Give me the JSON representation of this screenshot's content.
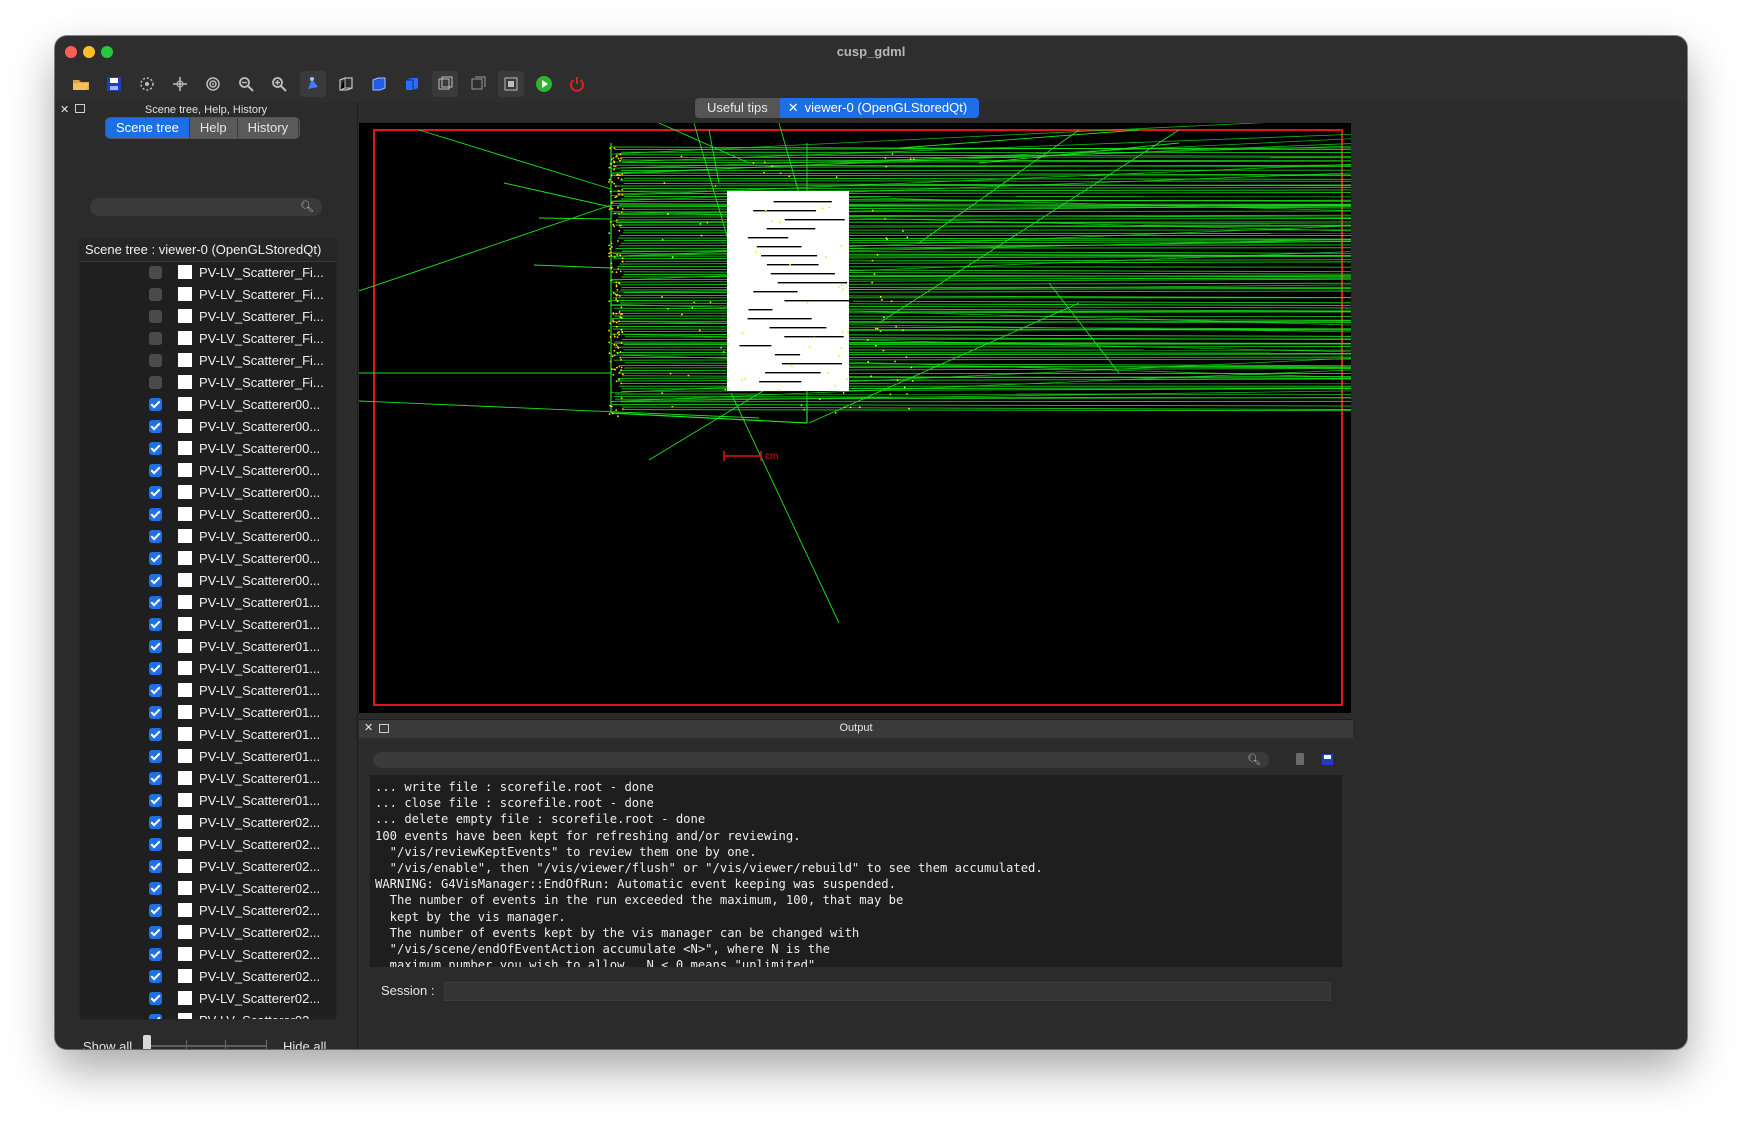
{
  "window": {
    "title": "cusp_gdml"
  },
  "toolbar": {
    "icons": [
      "open-folder-icon",
      "save-icon",
      "rotate-icon",
      "move-icon",
      "pick-icon",
      "zoom-out-icon",
      "zoom-in-icon",
      "perspective-icon",
      "hidden-line-icon",
      "solid-icon",
      "surface-icon",
      "wireframe-icon",
      "hidden-line-removal-icon",
      "hidden-surface-icon",
      "run-beam-icon",
      "exit-icon"
    ]
  },
  "left_dock": {
    "title": "Scene tree, Help, History",
    "tabs": [
      "Scene tree",
      "Help",
      "History"
    ],
    "selected_tab": "Scene tree",
    "search_placeholder": "",
    "tree_header": "Scene tree : viewer-0 (OpenGLStoredQt)",
    "items": [
      {
        "label": "PV-LV_Scatterer_Fi...",
        "checked": false
      },
      {
        "label": "PV-LV_Scatterer_Fi...",
        "checked": false
      },
      {
        "label": "PV-LV_Scatterer_Fi...",
        "checked": false
      },
      {
        "label": "PV-LV_Scatterer_Fi...",
        "checked": false
      },
      {
        "label": "PV-LV_Scatterer_Fi...",
        "checked": false
      },
      {
        "label": "PV-LV_Scatterer_Fi...",
        "checked": false
      },
      {
        "label": "PV-LV_Scatterer00...",
        "checked": true
      },
      {
        "label": "PV-LV_Scatterer00...",
        "checked": true
      },
      {
        "label": "PV-LV_Scatterer00...",
        "checked": true
      },
      {
        "label": "PV-LV_Scatterer00...",
        "checked": true
      },
      {
        "label": "PV-LV_Scatterer00...",
        "checked": true
      },
      {
        "label": "PV-LV_Scatterer00...",
        "checked": true
      },
      {
        "label": "PV-LV_Scatterer00...",
        "checked": true
      },
      {
        "label": "PV-LV_Scatterer00...",
        "checked": true
      },
      {
        "label": "PV-LV_Scatterer00...",
        "checked": true
      },
      {
        "label": "PV-LV_Scatterer01...",
        "checked": true
      },
      {
        "label": "PV-LV_Scatterer01...",
        "checked": true
      },
      {
        "label": "PV-LV_Scatterer01...",
        "checked": true
      },
      {
        "label": "PV-LV_Scatterer01...",
        "checked": true
      },
      {
        "label": "PV-LV_Scatterer01...",
        "checked": true
      },
      {
        "label": "PV-LV_Scatterer01...",
        "checked": true
      },
      {
        "label": "PV-LV_Scatterer01...",
        "checked": true
      },
      {
        "label": "PV-LV_Scatterer01...",
        "checked": true
      },
      {
        "label": "PV-LV_Scatterer01...",
        "checked": true
      },
      {
        "label": "PV-LV_Scatterer01...",
        "checked": true
      },
      {
        "label": "PV-LV_Scatterer02...",
        "checked": true
      },
      {
        "label": "PV-LV_Scatterer02...",
        "checked": true
      },
      {
        "label": "PV-LV_Scatterer02...",
        "checked": true
      },
      {
        "label": "PV-LV_Scatterer02...",
        "checked": true
      },
      {
        "label": "PV-LV_Scatterer02...",
        "checked": true
      },
      {
        "label": "PV-LV_Scatterer02...",
        "checked": true
      },
      {
        "label": "PV-LV_Scatterer02...",
        "checked": true
      },
      {
        "label": "PV-LV_Scatterer02...",
        "checked": true
      },
      {
        "label": "PV-LV_Scatterer02...",
        "checked": true
      },
      {
        "label": "PV-LV_Scatterer02...",
        "checked": true
      }
    ],
    "show_all": "Show all",
    "hide_all": "Hide all"
  },
  "viewer": {
    "tabs": [
      {
        "label": "Useful tips"
      },
      {
        "label": "viewer-0 (OpenGLStoredQt)",
        "close": "✕"
      }
    ],
    "scale_label": "cm",
    "colors": {
      "boundary": "#e0161b",
      "tracks": "#19e619",
      "steps": "#ffe400",
      "detector": "#ffffff"
    }
  },
  "output": {
    "title": "Output",
    "search_placeholder": "",
    "lines": [
      "... write file : scorefile.root - done",
      "... close file : scorefile.root - done",
      "... delete empty file : scorefile.root - done",
      "100 events have been kept for refreshing and/or reviewing.",
      "  \"/vis/reviewKeptEvents\" to review them one by one.",
      "  \"/vis/enable\", then \"/vis/viewer/flush\" or \"/vis/viewer/rebuild\" to see them accumulated.",
      "WARNING: G4VisManager::EndOfRun: Automatic event keeping was suspended.",
      "  The number of events in the run exceeded the maximum, 100, that may be",
      "  kept by the vis manager.",
      "  The number of events kept by the vis manager can be changed with",
      "  \"/vis/scene/endOfEventAction accumulate <N>\", where N is the",
      "  maximum number you wish to allow.  N < 0 means \"unlimited\"."
    ],
    "session_label": "Session :",
    "session_value": ""
  }
}
